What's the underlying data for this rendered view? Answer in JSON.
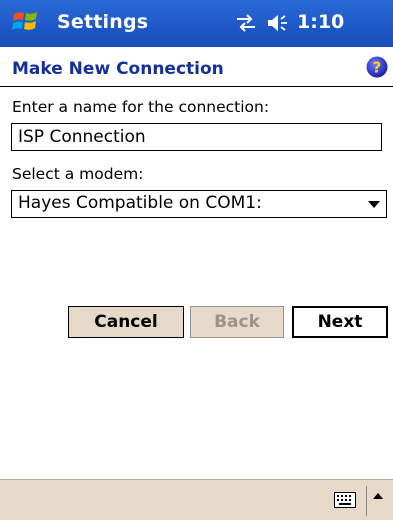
{
  "titlebar": {
    "app_title": "Settings",
    "clock": "1:10"
  },
  "header": {
    "title": "Make New Connection"
  },
  "form": {
    "name_label": "Enter a name for the connection:",
    "name_value": "ISP Connection",
    "modem_label": "Select a modem:",
    "modem_value": "Hayes Compatible on COM1:"
  },
  "buttons": {
    "cancel": "Cancel",
    "back": "Back",
    "next": "Next"
  },
  "icons": {
    "start": "windows-flag-icon",
    "connectivity": "connectivity-arrows-icon",
    "volume": "speaker-icon",
    "help": "help-icon",
    "keyboard": "keyboard-icon",
    "sip": "sip-arrow-up-icon"
  },
  "colors": {
    "titlebar": "#1d57c6",
    "page_title": "#15309a",
    "button_face": "#e7d9c9",
    "disabled_text": "#9b948c"
  }
}
